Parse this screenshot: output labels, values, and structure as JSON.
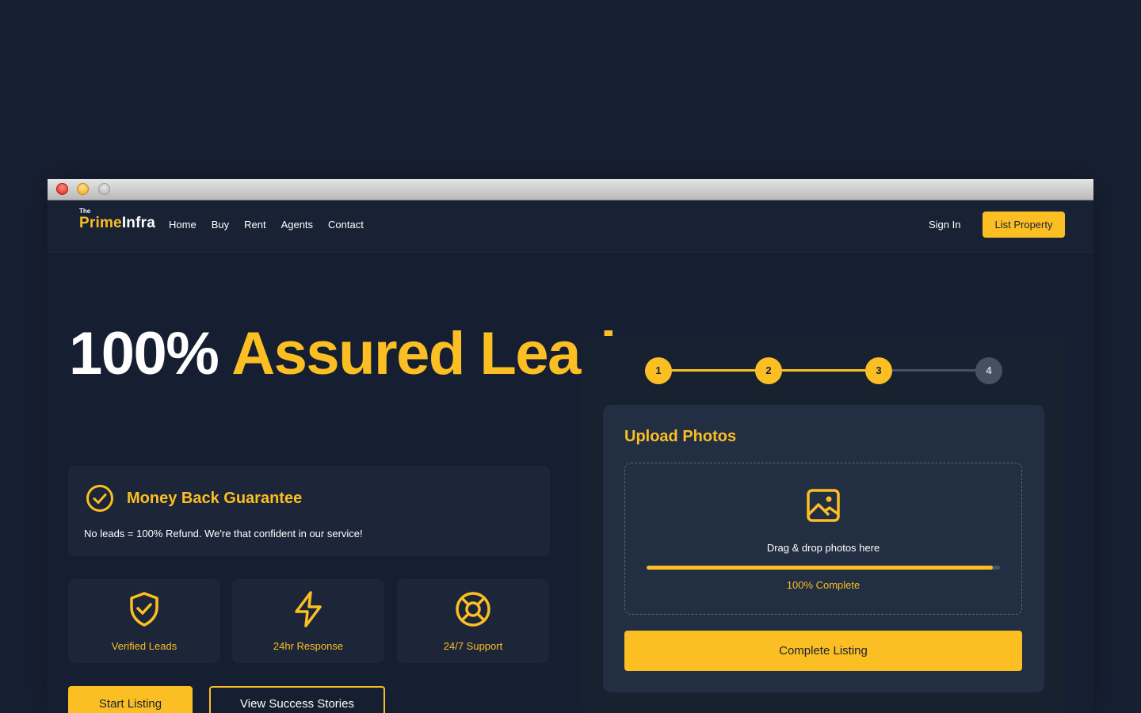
{
  "brand": {
    "the": "The",
    "prime": "Prime",
    "infra": "Infra"
  },
  "nav": {
    "links": [
      "Home",
      "Buy",
      "Rent",
      "Agents",
      "Contact"
    ],
    "sign_in": "Sign In",
    "list_property": "List Property"
  },
  "hero": {
    "title_white": "100%",
    "title_yellow": "Assured Leads"
  },
  "guarantee": {
    "title": "Money Back Guarantee",
    "description": "No leads = 100% Refund. We're that confident in our service!"
  },
  "features": [
    {
      "label": "Verified Leads",
      "icon": "shield-check-icon"
    },
    {
      "label": "24hr Response",
      "icon": "lightning-icon"
    },
    {
      "label": "24/7 Support",
      "icon": "lifebuoy-icon"
    }
  ],
  "cta": {
    "start": "Start Listing",
    "stories": "View Success Stories"
  },
  "stepper": {
    "steps": [
      "1",
      "2",
      "3",
      "4"
    ],
    "current_step": 3
  },
  "upload": {
    "title": "Upload Photos",
    "drop_text": "Drag & drop photos here",
    "progress": 1.0,
    "progress_text": "100% Complete",
    "complete_button": "Complete Listing"
  },
  "colors": {
    "accent": "#fbbf24",
    "background": "#172033",
    "card": "#1c2638",
    "inactive_step": "#465063"
  }
}
